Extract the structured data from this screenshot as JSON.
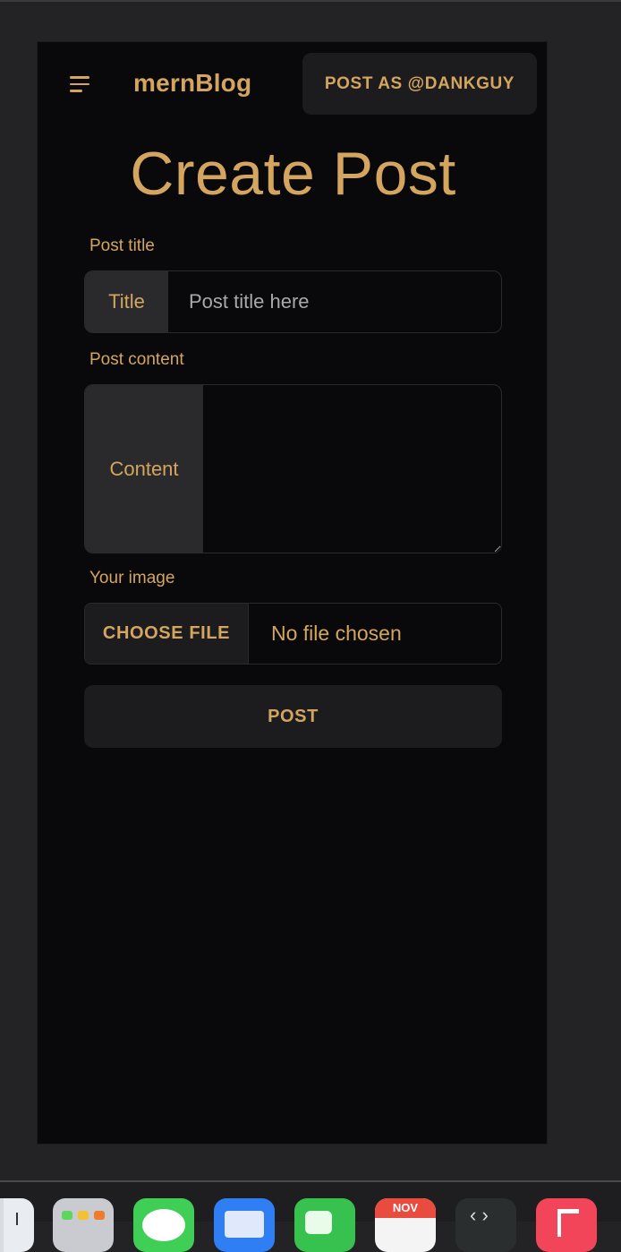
{
  "navbar": {
    "brand": "mernBlog",
    "post_as_label": "POST AS @DANKGUY"
  },
  "page": {
    "title": "Create Post"
  },
  "form": {
    "title_label": "Post title",
    "title_addon": "Title",
    "title_value": "",
    "title_placeholder": "Post title here",
    "content_label": "Post content",
    "content_addon": "Content",
    "content_value": "",
    "image_label": "Your image",
    "choose_file_label": "CHOOSE FILE",
    "file_status": "No file chosen",
    "submit_label": "POST"
  },
  "dock": {
    "calendar_month": "NOV",
    "apps": [
      "finder-icon",
      "launchpad-icon",
      "messages-icon",
      "mail-icon",
      "facetime-icon",
      "calendar-icon",
      "terminal-icon",
      "music-icon"
    ]
  },
  "colors": {
    "accent": "#d4a55e",
    "background": "#09090b",
    "surface": "#1c1c1f",
    "addon": "#2a2a2d",
    "outer": "#232325"
  }
}
